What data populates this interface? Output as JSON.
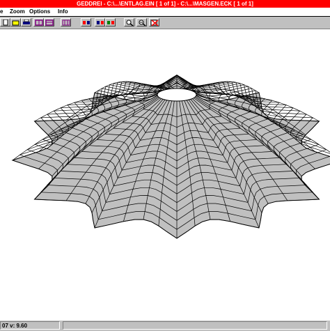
{
  "window": {
    "title": "GEDDREI - C:\\...\\ENTLAG.EIN [ 1 of  1] - C:\\...\\MASGEN.ECK [ 1 of  1]"
  },
  "menu": {
    "items": [
      {
        "label": "e"
      },
      {
        "label": "Zoom"
      },
      {
        "label": "Options"
      },
      {
        "label": "Info"
      }
    ]
  },
  "toolbar": {
    "buttons": [
      {
        "icon": "file-icon"
      },
      {
        "icon": "open-icon"
      },
      {
        "icon": "print-icon"
      },
      {
        "icon": "view-front-icon"
      },
      {
        "icon": "view-side-icon"
      },
      {
        "icon": "view-grid-icon"
      },
      {
        "icon": "mesh-red-icon"
      },
      {
        "icon": "mesh-blue-icon"
      },
      {
        "icon": "mesh-green-icon"
      },
      {
        "icon": "zoom-in-icon"
      },
      {
        "icon": "zoom-out-icon"
      },
      {
        "icon": "zoom-reset-icon"
      }
    ]
  },
  "status": {
    "text": "07 v:   9.60"
  },
  "colors": {
    "title_bar": "#ff0000",
    "surface_fill": "#c0c0c0",
    "mesh_line": "#000000",
    "chrome": "#c0c0c0"
  }
}
